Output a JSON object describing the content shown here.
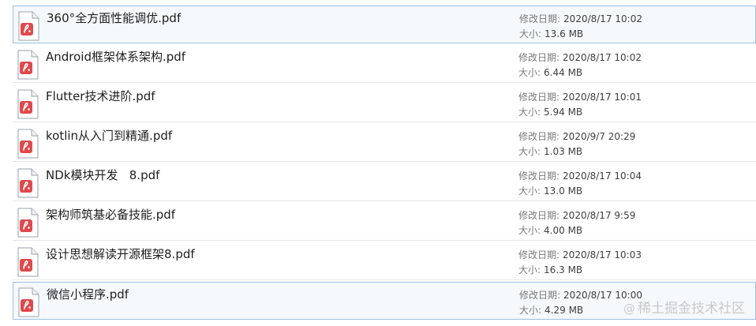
{
  "labels": {
    "date": "修改日期:",
    "size": "大小:"
  },
  "files": [
    {
      "name": "360°全方面性能调优.pdf",
      "date": "2020/8/17 10:02",
      "size": "13.6 MB",
      "selected": true
    },
    {
      "name": "Android框架体系架构.pdf",
      "date": "2020/8/17 10:02",
      "size": "6.44 MB"
    },
    {
      "name": "Flutter技术进阶.pdf",
      "date": "2020/8/17 10:01",
      "size": "5.94 MB"
    },
    {
      "name": "kotlin从入门到精通.pdf",
      "date": "2020/9/7 20:29",
      "size": "1.03 MB"
    },
    {
      "name": "NDk模块开发   8.pdf",
      "date": "2020/8/17 10:04",
      "size": "13.0 MB"
    },
    {
      "name": "架构师筑基必备技能.pdf",
      "date": "2020/8/17 9:59",
      "size": "4.00 MB"
    },
    {
      "name": "设计思想解读开源框架8.pdf",
      "date": "2020/8/17 10:03",
      "size": "16.3 MB"
    },
    {
      "name": "微信小程序.pdf",
      "date": "2020/8/17 10:00",
      "size": "4.29 MB",
      "selected": true
    }
  ],
  "watermark": {
    "at": "@",
    "text": "稀土掘金技术社区"
  },
  "icon": "pdf-file-icon",
  "colors": {
    "pdf_accent": "#e0494c",
    "selection_border": "#9ec0e0"
  }
}
